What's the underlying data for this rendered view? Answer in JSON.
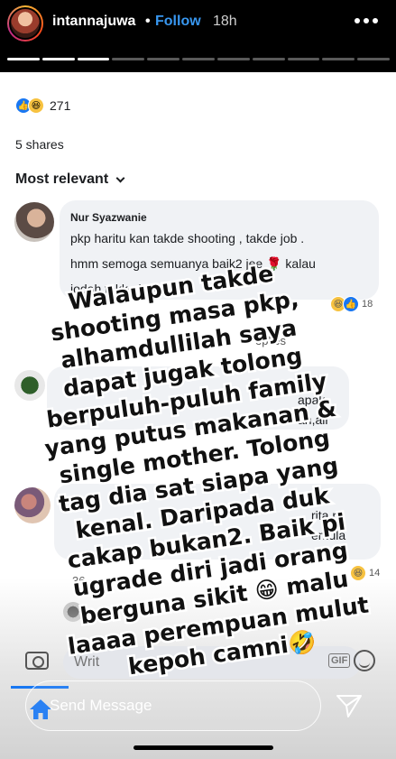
{
  "story": {
    "username": "intannajuwa",
    "separator": "•",
    "follow_label": "Follow",
    "timestamp": "18h",
    "segments_total": 11,
    "segments_viewed": 3
  },
  "post": {
    "reaction_count": "271",
    "shares": "5 shares",
    "sort_label": "Most relevant"
  },
  "comments": [
    {
      "name": "Nur Syazwanie",
      "lines": [
        "pkp haritu kan takde shooting , takde job .",
        "hmm semoga semuanya baik2 jee 🌹 kalau",
        "jodoh takko          kkk 😛"
      ],
      "reaction_count": "18"
    },
    {
      "partial_lines": [
        "apak",
        "ah,air"
      ]
    },
    {
      "partial_lines": [
        "rita ni",
        "emula"
      ],
      "time": "36",
      "reaction_count": "14"
    }
  ],
  "view_replies": "eplies",
  "composer": {
    "placeholder": "Writ"
  },
  "reply_bar": {
    "placeholder": "Send Message"
  },
  "caption": {
    "lines": [
      "Walaupun takde",
      "shooting masa pkp,",
      "alhamdullilah saya",
      "dapat jugak tolong",
      "berpuluh-puluh family",
      "yang putus makanan &",
      "single mother. Tolong",
      "tag dia sat siapa yang",
      "kenal. Daripada duk",
      "cakap bukan2. Baik pi",
      "ugrade diri jadi orang",
      "berguna sikit 😁 malu",
      "laaaa perempuan mulut",
      "kepoh camni🤣"
    ]
  },
  "icons": {
    "more": "more-horizontal-icon",
    "like": "like-reaction-icon",
    "haha": "haha-reaction-icon",
    "camera": "camera-icon",
    "gif": "gif-icon",
    "emoji": "smile-icon",
    "home": "home-icon",
    "direct": "paper-plane-icon"
  },
  "colors": {
    "follow": "#3897f0",
    "fb_blue": "#1877f2",
    "bubble": "#f0f2f5"
  }
}
